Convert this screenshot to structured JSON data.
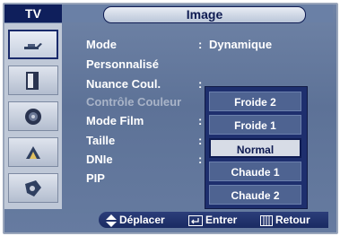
{
  "header": {
    "tab_label": "TV",
    "title": "Image"
  },
  "sidebar": {
    "items": [
      {
        "icon": "antenna-icon",
        "active": true
      },
      {
        "icon": "tv-screen-icon",
        "active": false
      },
      {
        "icon": "speaker-icon",
        "active": false
      },
      {
        "icon": "satellite-icon",
        "active": false
      },
      {
        "icon": "settings-icon",
        "active": false
      }
    ]
  },
  "menu": {
    "rows": [
      {
        "label": "Mode",
        "value": "Dynamique",
        "has_colon": true,
        "disabled": false
      },
      {
        "label": "Personnalisé",
        "value": "",
        "has_colon": false,
        "disabled": false
      },
      {
        "label": "Nuance Coul.",
        "value": "",
        "has_colon": true,
        "disabled": false
      },
      {
        "label": "Contrôle Couleur",
        "value": "",
        "has_colon": false,
        "disabled": true
      },
      {
        "label": "Mode Film",
        "value": "",
        "has_colon": true,
        "disabled": false
      },
      {
        "label": "Taille",
        "value": "",
        "has_colon": true,
        "disabled": false
      },
      {
        "label": "DNIe",
        "value": "",
        "has_colon": true,
        "disabled": false
      },
      {
        "label": "PIP",
        "value": "",
        "has_colon": false,
        "disabled": false
      }
    ]
  },
  "dropdown": {
    "options": [
      "Froide 2",
      "Froide 1",
      "Normal",
      "Chaude 1",
      "Chaude 2"
    ],
    "selected": "Normal"
  },
  "footer": {
    "move_label": "Déplacer",
    "enter_label": "Entrer",
    "return_label": "Retour"
  },
  "colors": {
    "panel_bg": "#5d7297",
    "header_dark": "#0f1f5c",
    "text": "#ffffff",
    "disabled_text": "#a9b4c8",
    "dropdown_bg": "#1e2f6e",
    "selected_option_bg": "#d7dce6"
  }
}
